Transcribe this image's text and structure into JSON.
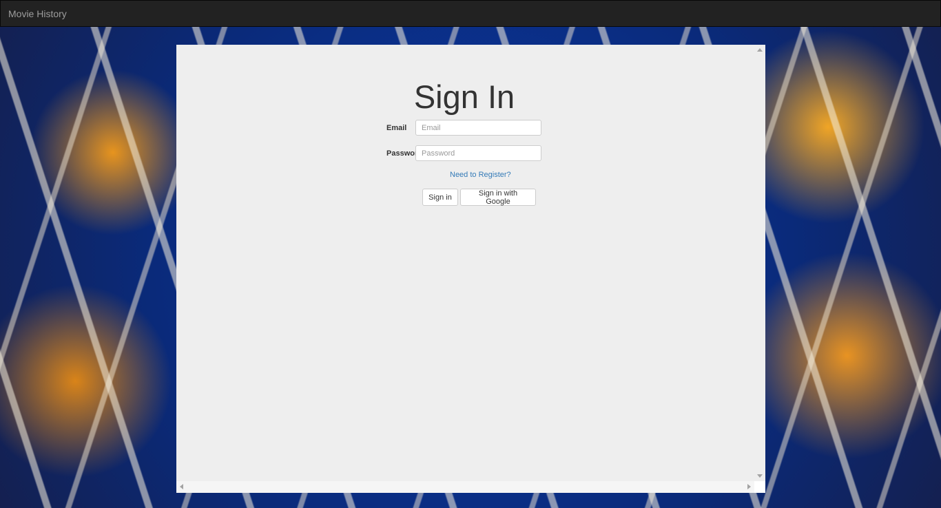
{
  "navbar": {
    "brand": "Movie History"
  },
  "signin": {
    "title": "Sign In",
    "email_label": "Email",
    "email_placeholder": "Email",
    "email_value": "",
    "password_label": "Password",
    "password_placeholder": "Password",
    "password_value": "",
    "register_link": "Need to Register?",
    "signin_button": "Sign in",
    "google_button": "Sign in with Google"
  },
  "colors": {
    "navbar_bg": "#222222",
    "panel_bg": "#eeeeee",
    "link": "#337ab7"
  }
}
